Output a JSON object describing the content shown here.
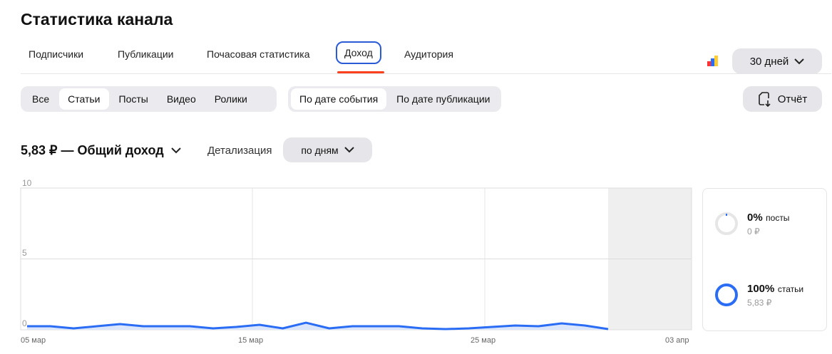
{
  "title": "Статистика канала",
  "tabs": [
    {
      "label": "Подписчики"
    },
    {
      "label": "Публикации"
    },
    {
      "label": "Почасовая статистика"
    },
    {
      "label": "Доход"
    },
    {
      "label": "Аудитория"
    }
  ],
  "period": "30 дней",
  "content_filter": [
    "Все",
    "Статьи",
    "Посты",
    "Видео",
    "Ролики"
  ],
  "date_filter": [
    "По дате события",
    "По дате публикации"
  ],
  "report_label": "Отчёт",
  "summary": "5,83 ₽ — Общий доход",
  "detail_label": "Детализация",
  "detail_value": "по дням",
  "colors": {
    "accent": "#2a6df4",
    "tab_underline": "#fc3f1d"
  },
  "chart_data": {
    "type": "area",
    "ylim": [
      0,
      10
    ],
    "yticks": [
      "0",
      "5",
      "10"
    ],
    "xticks": [
      "05 мар",
      "15 мар",
      "25 мар",
      "03 апр"
    ],
    "x_start": "05 мар",
    "values": [
      0.25,
      0.25,
      0.1,
      0.25,
      0.4,
      0.25,
      0.25,
      0.25,
      0.1,
      0.2,
      0.35,
      0.1,
      0.5,
      0.1,
      0.25,
      0.25,
      0.25,
      0.1,
      0.05,
      0.1,
      0.2,
      0.3,
      0.25,
      0.45,
      0.3,
      0.05
    ]
  },
  "breakdown": [
    {
      "percent": "0%",
      "label": "посты",
      "amount": "0 ₽",
      "fraction": 0.0
    },
    {
      "percent": "100%",
      "label": "статьи",
      "amount": "5,83 ₽",
      "fraction": 1.0
    }
  ]
}
